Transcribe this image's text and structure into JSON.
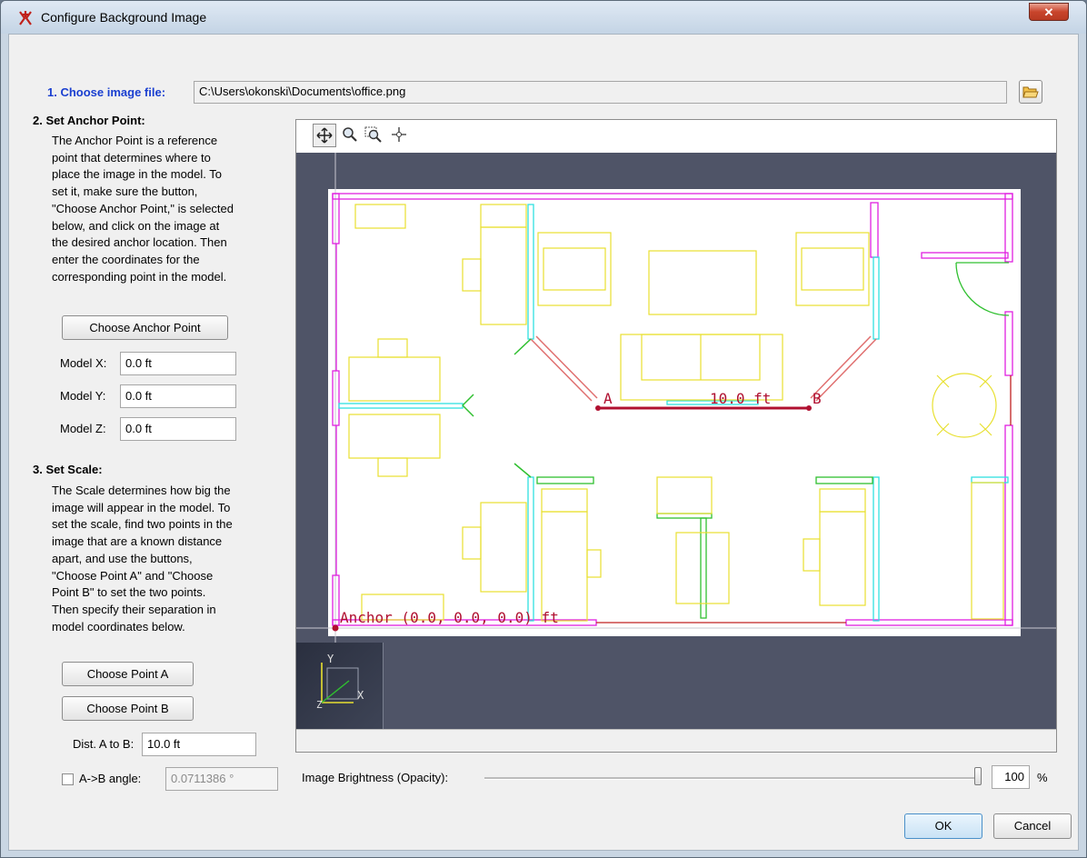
{
  "window": {
    "title": "Configure Background Image"
  },
  "choose_file": {
    "label": "1. Choose image file:",
    "path": "C:\\Users\\okonski\\Documents\\office.png",
    "browse_icon": "folder-open-icon"
  },
  "anchor": {
    "heading": "2. Set Anchor Point:",
    "description": "The Anchor Point is a reference\npoint that determines where to\nplace the image in the model.  To\nset it, make sure the button,\n\"Choose Anchor Point,\" is selected\nbelow, and click on the image at\nthe desired anchor location.  Then\nenter the coordinates for the\ncorresponding point in the model.",
    "button": "Choose Anchor Point",
    "x_label": "Model X:",
    "x_value": "0.0 ft",
    "y_label": "Model Y:",
    "y_value": "0.0 ft",
    "z_label": "Model Z:",
    "z_value": "0.0 ft"
  },
  "scale": {
    "heading": "3. Set Scale:",
    "description": "The Scale determines how big the\nimage will appear in the model.  To\nset the scale, find two points in the\nimage that are a known distance\napart, and use the buttons,\n\"Choose Point A\" and \"Choose\nPoint B\" to set the two points.\nThen specify their separation in\nmodel coordinates below.",
    "button_a": "Choose Point A",
    "button_b": "Choose Point B",
    "dist_label": "Dist. A to B:",
    "dist_value": "10.0 ft",
    "angle_label": "A->B angle:",
    "angle_value": "0.0711386 °",
    "angle_checked": false
  },
  "viewer": {
    "tools": [
      "pan-icon",
      "zoom-icon",
      "zoom-region-icon",
      "center-icon"
    ],
    "overlay": {
      "point_a": "A",
      "point_b": "B",
      "distance": "10.0 ft",
      "anchor": "Anchor (0.0, 0.0, 0.0) ft"
    },
    "axes": {
      "x": "X",
      "y": "Y",
      "z": "Z"
    }
  },
  "brightness": {
    "label": "Image Brightness (Opacity):",
    "value": "100",
    "unit": "%",
    "level_percent": 100
  },
  "buttons": {
    "ok": "OK",
    "cancel": "Cancel"
  },
  "colors": {
    "title_link": "#1a3fd0",
    "canvas_bg": "#4f5467",
    "measure_line": "#b01030"
  }
}
